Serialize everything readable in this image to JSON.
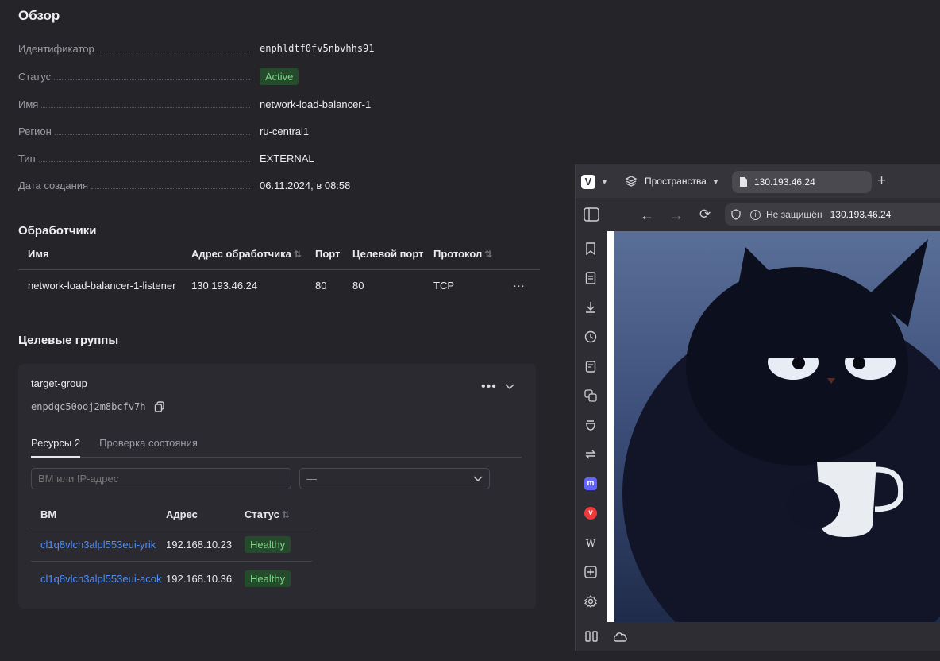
{
  "overview": {
    "title": "Обзор",
    "rows": [
      {
        "label": "Идентификатор",
        "value": "enphldtf0fv5nbvhhs91"
      },
      {
        "label": "Статус",
        "value": "Active"
      },
      {
        "label": "Имя",
        "value": "network-load-balancer-1"
      },
      {
        "label": "Регион",
        "value": "ru-central1"
      },
      {
        "label": "Тип",
        "value": "EXTERNAL"
      },
      {
        "label": "Дата создания",
        "value": "06.11.2024, в 08:58"
      }
    ]
  },
  "listeners": {
    "title": "Обработчики",
    "headers": {
      "name": "Имя",
      "address": "Адрес обработчика",
      "port": "Порт",
      "target_port": "Целевой порт",
      "protocol": "Протокол"
    },
    "rows": [
      {
        "name": "network-load-balancer-1-listener",
        "address": "130.193.46.24",
        "port": "80",
        "target_port": "80",
        "protocol": "TCP"
      }
    ]
  },
  "target_groups": {
    "title": "Целевые группы",
    "group": {
      "name": "target-group",
      "id": "enpdqc50ooj2m8bcfv7h",
      "tabs": [
        "Ресурсы 2",
        "Проверка состояния"
      ],
      "search_placeholder": "ВМ или IP-адрес",
      "select_value": "—",
      "headers": {
        "vm": "ВМ",
        "address": "Адрес",
        "status": "Статус"
      },
      "rows": [
        {
          "vm": "cl1q8vlch3alpl553eui-yrik",
          "address": "192.168.10.23",
          "status": "Healthy"
        },
        {
          "vm": "cl1q8vlch3alpl553eui-acok",
          "address": "192.168.10.36",
          "status": "Healthy"
        }
      ]
    }
  },
  "browser": {
    "spaces_label": "Пространства",
    "tab_title": "130.193.46.24",
    "security_label": "Не защищён",
    "url": "130.193.46.24",
    "wiki_letter": "W"
  },
  "colors": {
    "accent_link": "#4f8ef7",
    "badge_bg": "#264a2c",
    "badge_text": "#7dd48a"
  }
}
